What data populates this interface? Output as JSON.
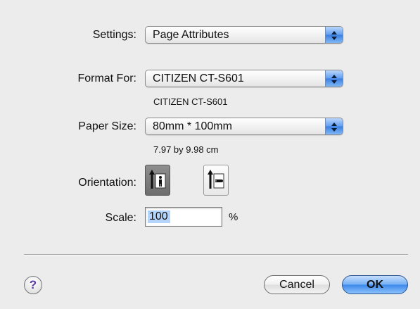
{
  "settings": {
    "label": "Settings:",
    "value": "Page Attributes"
  },
  "format_for": {
    "label": "Format For:",
    "value": "CITIZEN CT-S601",
    "subtext": "CITIZEN CT-S601"
  },
  "paper_size": {
    "label": "Paper Size:",
    "value": "80mm * 100mm",
    "subtext": "7.97 by 9.98 cm"
  },
  "orientation": {
    "label": "Orientation:",
    "options": [
      {
        "name": "portrait",
        "selected": true
      },
      {
        "name": "landscape",
        "selected": false
      }
    ]
  },
  "scale": {
    "label": "Scale:",
    "value": "100",
    "unit": "%"
  },
  "buttons": {
    "cancel": "Cancel",
    "ok": "OK",
    "help": "?"
  },
  "colors": {
    "accent": "#3b87ea",
    "background": "#ececec",
    "selection": "#b5d4fc"
  }
}
